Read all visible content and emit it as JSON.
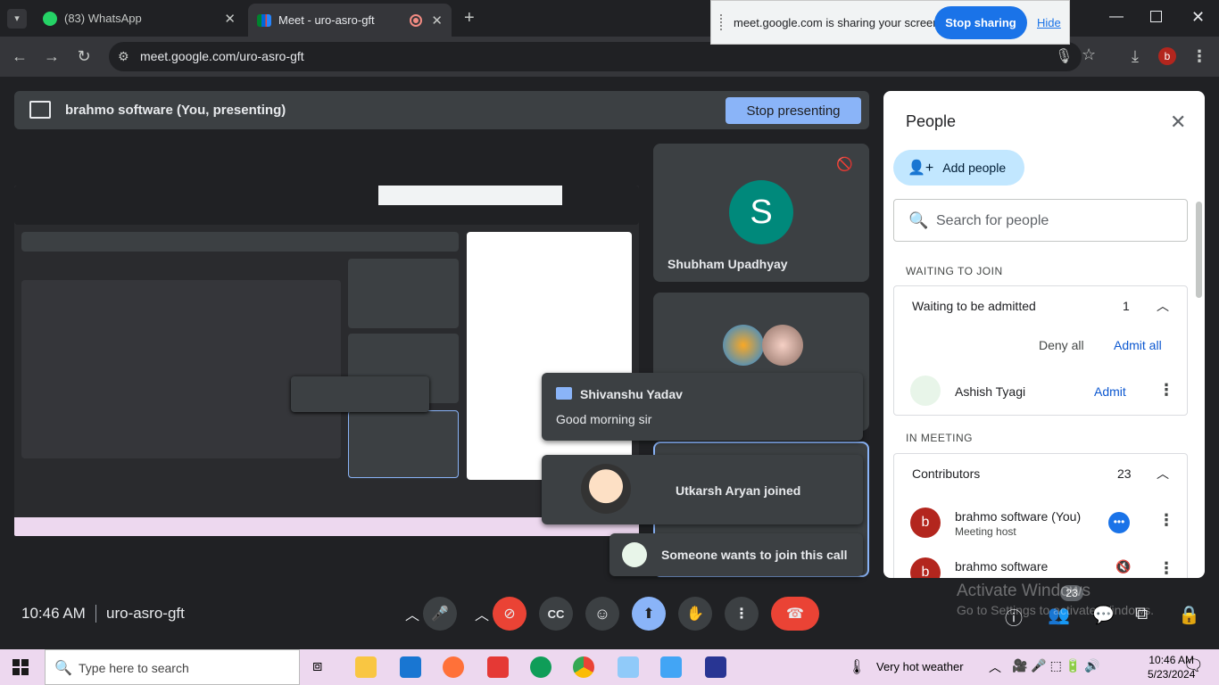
{
  "browser": {
    "tabs": [
      {
        "title": "(83) WhatsApp"
      },
      {
        "title": "Meet - uro-asro-gft"
      }
    ],
    "url": "meet.google.com/uro-asro-gft"
  },
  "share_bar": {
    "text": "meet.google.com is sharing your screen.",
    "stop_label": "Stop sharing",
    "hide_label": "Hide"
  },
  "presenting": {
    "label": "brahmo software (You, presenting)",
    "stop_label": "Stop presenting"
  },
  "tiles": {
    "shubham": {
      "initial": "S",
      "name": "Shubham Upadhyay"
    }
  },
  "notifications": {
    "chat_sender": "Shivanshu Yadav",
    "chat_text": "Good morning sir",
    "joined": "Utkarsh Aryan joined",
    "knock": "Someone wants to join this call"
  },
  "people": {
    "title": "People",
    "add_label": "Add people",
    "search_placeholder": "Search for people",
    "waiting_section": "WAITING TO JOIN",
    "waiting_group": "Waiting to be admitted",
    "waiting_count": "1",
    "deny_all": "Deny all",
    "admit_all": "Admit all",
    "waiting_person": "Ashish Tyagi",
    "admit": "Admit",
    "in_meeting_section": "IN MEETING",
    "contributors": "Contributors",
    "contributors_count": "23",
    "p1_name": "brahmo software (You)",
    "p1_role": "Meeting host",
    "p1_initial": "b",
    "p2_name": "brahmo software",
    "p2_initial": "b"
  },
  "bottom": {
    "time": "10:46 AM",
    "code": "uro-asro-gft",
    "people_badge": "23"
  },
  "watermark": {
    "line1": "Activate Windows",
    "line2": "Go to Settings to activate Windows."
  },
  "taskbar": {
    "search": "Type here to search",
    "weather": "Very hot weather",
    "time": "10:46 AM",
    "date": "5/23/2024"
  }
}
